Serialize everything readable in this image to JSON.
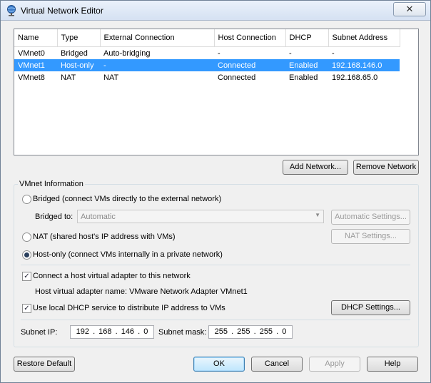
{
  "window": {
    "title": "Virtual Network Editor",
    "close_glyph": "✕"
  },
  "networks": {
    "columns": [
      "Name",
      "Type",
      "External Connection",
      "Host Connection",
      "DHCP",
      "Subnet Address"
    ],
    "rows": [
      {
        "name": "VMnet0",
        "type": "Bridged",
        "external": "Auto-bridging",
        "host": "-",
        "dhcp": "-",
        "subnet": "-"
      },
      {
        "name": "VMnet1",
        "type": "Host-only",
        "external": "-",
        "host": "Connected",
        "dhcp": "Enabled",
        "subnet": "192.168.146.0",
        "selected": true
      },
      {
        "name": "VMnet8",
        "type": "NAT",
        "external": "NAT",
        "host": "Connected",
        "dhcp": "Enabled",
        "subnet": "192.168.65.0"
      }
    ]
  },
  "buttons": {
    "add_network": "Add Network...",
    "remove_network": "Remove Network",
    "automatic_settings": "Automatic Settings...",
    "nat_settings": "NAT Settings...",
    "dhcp_settings": "DHCP Settings...",
    "restore_default": "Restore Default",
    "ok": "OK",
    "cancel": "Cancel",
    "apply": "Apply",
    "help": "Help"
  },
  "vmnet_info": {
    "group_label": "VMnet Information",
    "bridged_label": "Bridged (connect VMs directly to the external network)",
    "bridged_to_label": "Bridged to:",
    "bridged_to_value": "Automatic",
    "nat_label": "NAT (shared host's IP address with VMs)",
    "hostonly_label": "Host-only (connect VMs internally in a private network)",
    "selected_mode": "host-only",
    "connect_adapter_label": "Connect a host virtual adapter to this network",
    "connect_adapter_checked": true,
    "adapter_name_text": "Host virtual adapter name: VMware Network Adapter VMnet1",
    "dhcp_label": "Use local DHCP service to distribute IP address to VMs",
    "dhcp_checked": true,
    "subnet_ip_label": "Subnet IP:",
    "subnet_ip_value": "192 . 168 . 146 .  0",
    "subnet_mask_label": "Subnet mask:",
    "subnet_mask_value": "255 . 255 . 255 .  0"
  },
  "icons": {
    "app": "network-globe-icon",
    "dropdown": "chevron-down-icon",
    "check": "✓"
  }
}
